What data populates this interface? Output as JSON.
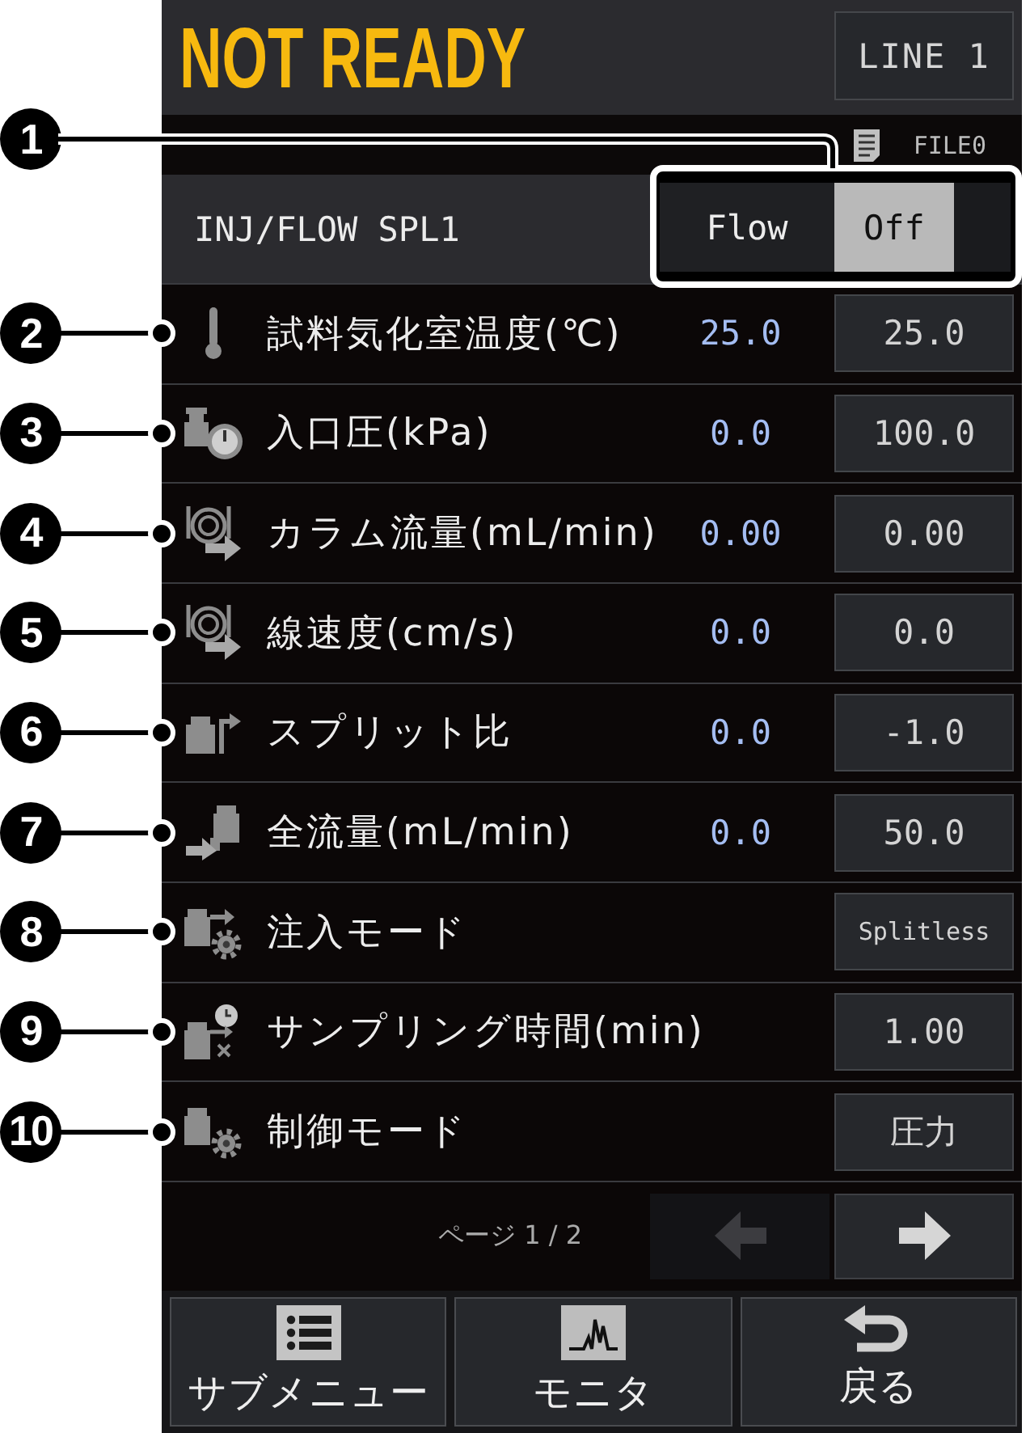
{
  "header": {
    "status": "NOT READY",
    "line_button": "LINE 1"
  },
  "file_bar": {
    "file_name": "FILE0"
  },
  "section": {
    "title": "INJ/FLOW SPL1",
    "callout": "1",
    "flow_toggle": {
      "label": "Flow",
      "value": "Off",
      "on": false
    }
  },
  "parameters": [
    {
      "kind": "temperature",
      "callout": "2",
      "label": "試料気化室温度(℃)",
      "current": "25.0",
      "setting": "25.0"
    },
    {
      "kind": "pressure",
      "callout": "3",
      "label": "入口圧(kPa)",
      "current": "0.0",
      "setting": "100.0"
    },
    {
      "kind": "column",
      "callout": "4",
      "label": "カラム流量(mL/min)",
      "current": "0.00",
      "setting": "0.00"
    },
    {
      "kind": "velocity",
      "callout": "5",
      "label": "線速度(cm/s)",
      "current": "0.0",
      "setting": "0.0"
    },
    {
      "kind": "split",
      "callout": "6",
      "label": "スプリット比",
      "current": "0.0",
      "setting": "-1.0"
    },
    {
      "kind": "total",
      "callout": "7",
      "label": "全流量(mL/min)",
      "current": "0.0",
      "setting": "50.0"
    },
    {
      "kind": "injection",
      "callout": "8",
      "label": "注入モード",
      "setting": "Splitless"
    },
    {
      "kind": "timer",
      "callout": "9",
      "label": "サンプリング時間(min)",
      "setting": "1.00"
    },
    {
      "kind": "control",
      "callout": "10",
      "label": "制御モード",
      "setting": "圧力"
    }
  ],
  "pagination": {
    "label": "ページ 1 / 2",
    "previous": {
      "disabled": true
    },
    "next": {
      "disabled": false
    }
  },
  "nav_buttons": [
    {
      "kind": "submenu",
      "label": "サブメニュー"
    },
    {
      "kind": "monitor",
      "label": "モニタ"
    },
    {
      "kind": "back",
      "label": "戻る"
    }
  ]
}
